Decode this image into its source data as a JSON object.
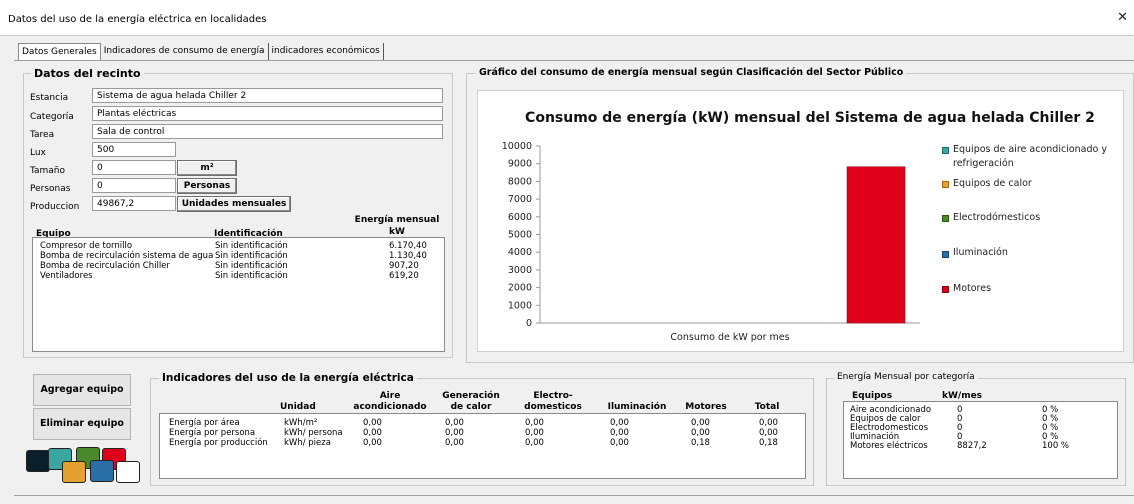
{
  "window": {
    "title": "Datos del uso de la energía eléctrica en localidades",
    "close_glyph": "✕"
  },
  "tabs": [
    {
      "label": "Datos Generales"
    },
    {
      "label": "Indicadores de consumo de energía"
    },
    {
      "label": "indicadores económicos"
    }
  ],
  "recinto": {
    "title": "Datos del recinto",
    "fields": {
      "estancia": {
        "label": "Estancia",
        "value": "Sistema de agua helada Chiller 2"
      },
      "categoria": {
        "label": "Categoría",
        "value": "Plantas eléctricas"
      },
      "tarea": {
        "label": "Tarea",
        "value": "Sala de control"
      },
      "lux": {
        "label": "Lux",
        "value": "500"
      },
      "tamano": {
        "label": "Tamaño",
        "value": "0",
        "unit": "m²"
      },
      "personas": {
        "label": "Personas",
        "value": "0",
        "unit": "Personas"
      },
      "produccion": {
        "label": "Produccion",
        "value": "49867,2",
        "unit": "Unidades mensuales"
      }
    },
    "equipment": {
      "headers": {
        "equipo": "Equipo",
        "identificacion": "Identificación",
        "energia_line1": "Energía mensual",
        "energia_line2": "kW"
      },
      "rows": [
        {
          "equipo": "Compresor de tornillo",
          "identificacion": "Sin identificación",
          "energia": "6.170,40"
        },
        {
          "equipo": "Bomba de recirculación sistema de agua",
          "identificacion": "Sin identificación",
          "energia": "1.130,40"
        },
        {
          "equipo": "Bomba de recirculación Chiller",
          "identificacion": "Sin identificación",
          "energia": "907,20"
        },
        {
          "equipo": "Ventiladores",
          "identificacion": "Sin identificación",
          "energia": "619,20"
        }
      ]
    }
  },
  "chart_group": {
    "title": "Gráfico del consumo de energía mensual según Clasificación del Sector  Público"
  },
  "chart_data": {
    "type": "bar",
    "title": "Consumo de energía (kW) mensual del Sistema de agua helada Chiller 2",
    "categories": [
      "Consumo de kW por mes"
    ],
    "ylim": [
      0,
      10000
    ],
    "yticks": [
      "0",
      "1000",
      "2000",
      "3000",
      "4000",
      "5000",
      "6000",
      "7000",
      "8000",
      "9000",
      "10000"
    ],
    "grid": false,
    "legend_position": "right",
    "series": [
      {
        "name": "Equipos de aire acondicionado y refrigeración",
        "values": [
          0
        ],
        "color": "#3aa6a0"
      },
      {
        "name": "Equipos de calor",
        "values": [
          0
        ],
        "color": "#e6a030"
      },
      {
        "name": "Electrodómesticos",
        "values": [
          0
        ],
        "color": "#4a8a2a"
      },
      {
        "name": "Iluminación",
        "values": [
          0
        ],
        "color": "#2a6fa8"
      },
      {
        "name": "Motores",
        "values": [
          8827.2
        ],
        "color": "#e0001b"
      }
    ]
  },
  "actions": {
    "agregar": "Agregar equipo",
    "eliminar": "Eliminar equipo"
  },
  "palette_tiles": [
    {
      "color": "#0b1f2a",
      "icon": "swatch-black"
    },
    {
      "color": "#3aa6a0",
      "icon": "swatch-teal"
    },
    {
      "color": "#e6a030",
      "icon": "swatch-orange"
    },
    {
      "color": "#4a8a2a",
      "icon": "swatch-green"
    },
    {
      "color": "#2a6fa8",
      "icon": "swatch-blue"
    },
    {
      "color": "#e0001b",
      "icon": "swatch-red"
    },
    {
      "color": "#ffffff",
      "icon": "swatch-white"
    }
  ],
  "indicadores": {
    "title": "Indicadores del uso de la energía eléctrica",
    "headers": {
      "unidad": "Unidad",
      "aire_1": "Aire",
      "aire_2": "acondicionado",
      "gen_1": "Generación",
      "gen_2": "de calor",
      "elec_1": "Electro-",
      "elec_2": "domesticos",
      "ilum": "Iluminación",
      "motores": "Motores",
      "total": "Total"
    },
    "rows": [
      {
        "name": "Energía por área",
        "unidad": "kWh/m²",
        "aire": "0,00",
        "gen": "0,00",
        "elec": "0,00",
        "ilum": "0,00",
        "mot": "0,00",
        "total": "0,00"
      },
      {
        "name": "Energía por persona",
        "unidad": "kWh/ persona",
        "aire": "0,00",
        "gen": "0,00",
        "elec": "0,00",
        "ilum": "0,00",
        "mot": "0,00",
        "total": "0,00"
      },
      {
        "name": "Energía por producción",
        "unidad": "kWh/ pieza",
        "aire": "0,00",
        "gen": "0,00",
        "elec": "0,00",
        "ilum": "0,00",
        "mot": "0,18",
        "total": "0,18"
      }
    ]
  },
  "categoria_mensual": {
    "title": "Energía Mensual por categoría",
    "headers": {
      "equipos": "Equipos",
      "kw": "kW/mes"
    },
    "rows": [
      {
        "name": "Aire acondicionado",
        "kw": "0",
        "pct": "0 %"
      },
      {
        "name": "Equipos de calor",
        "kw": "0",
        "pct": "0 %"
      },
      {
        "name": "Electrodomesticos",
        "kw": "0",
        "pct": "0 %"
      },
      {
        "name": "Iluminación",
        "kw": "0",
        "pct": "0 %"
      },
      {
        "name": "Motores eléctricos",
        "kw": "8827,2",
        "pct": "100 %"
      }
    ]
  }
}
